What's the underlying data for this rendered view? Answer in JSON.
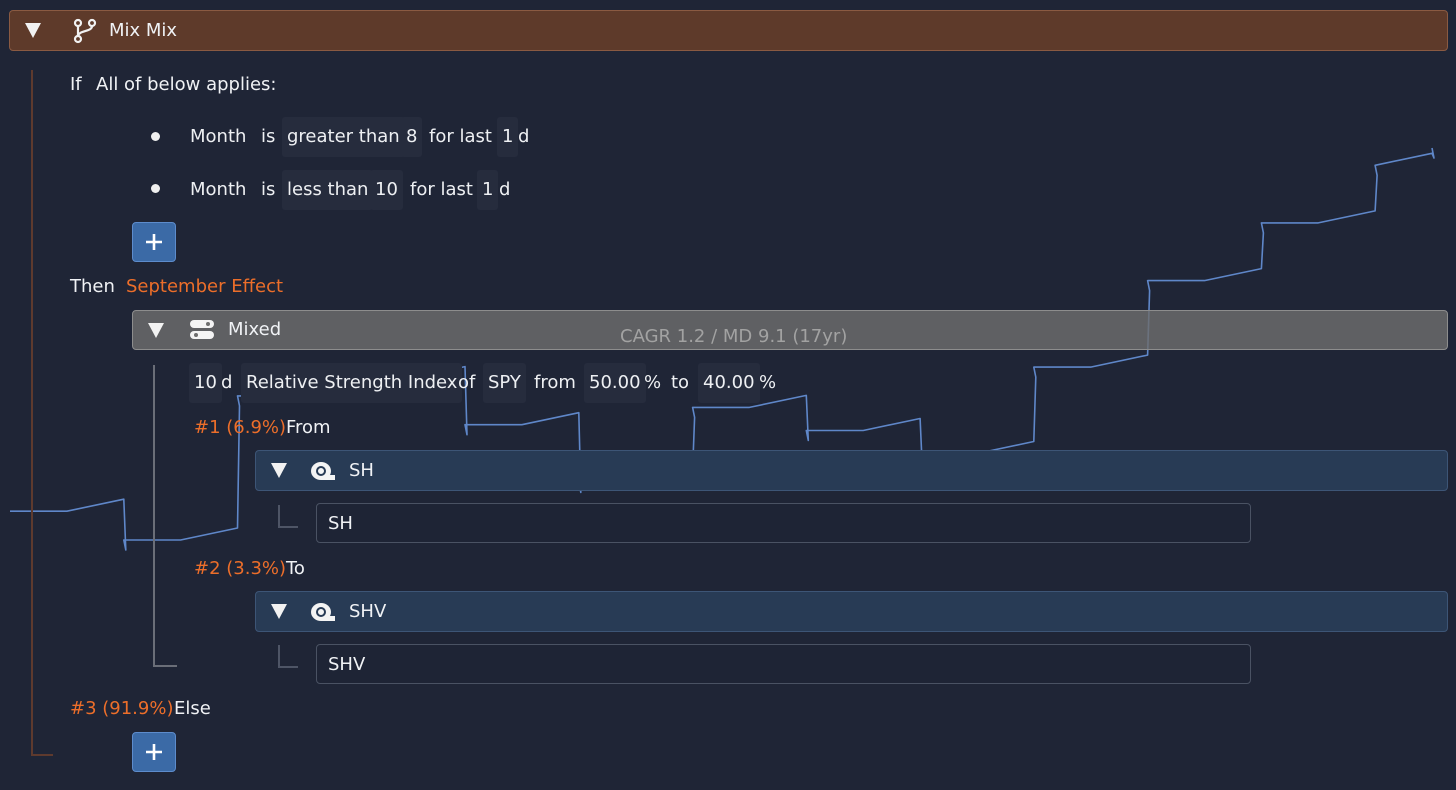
{
  "root": {
    "title": "Mix Mix",
    "icon": "git-branch-icon"
  },
  "if_clause": {
    "if_label": "If",
    "applies_label": "All of below applies:"
  },
  "conditions": [
    {
      "field": "Month",
      "is": "is",
      "op": "greater than",
      "value": "8",
      "for_last": "for last",
      "n": "1",
      "unit": "d"
    },
    {
      "field": "Month",
      "is": "is",
      "op": "less than",
      "value": "10",
      "for_last": "for last",
      "n": "1",
      "unit": "d"
    }
  ],
  "then_clause": {
    "then_label": "Then",
    "name": "September Effect"
  },
  "mixed": {
    "title": "Mixed",
    "icon": "toggle-stack-icon",
    "overlay_text": "CAGR 1.2 / MD 9.1 (17yr)"
  },
  "indicator": {
    "period": "10",
    "period_unit": "d",
    "name": "Relative Strength Index",
    "of": "of",
    "ticker": "SPY",
    "from_label": "from",
    "from_value": "50.00",
    "from_unit": "%",
    "to_label": "to",
    "to_value": "40.00",
    "to_unit": "%"
  },
  "branches": [
    {
      "tag": "#1 (6.9%)",
      "label": "From",
      "group": "SH",
      "ticker": "SH",
      "icon": "coin-icon"
    },
    {
      "tag": "#2 (3.3%)",
      "label": "To",
      "group": "SHV",
      "ticker": "SHV",
      "icon": "coin-icon"
    }
  ],
  "else_clause": {
    "tag": "#3 (91.9%)",
    "label": "Else"
  },
  "colors": {
    "header_brown": "#5e3a2a",
    "accent_orange": "#ec6e2a",
    "button_blue": "#3b6aa6",
    "chart_line": "#5f87c9",
    "subheader_navy": "#283b55"
  },
  "chart_data": {
    "type": "line",
    "note_axes": "no axes, ticks or labels shown",
    "x": [
      0,
      1,
      2,
      3,
      4,
      5,
      6,
      7,
      8,
      9,
      10,
      11,
      12,
      13,
      14,
      15,
      16,
      17,
      18,
      19,
      20,
      21,
      22,
      23,
      24,
      25
    ],
    "series": [
      {
        "values": [
          100,
          100,
          95,
          95,
          120,
          120,
          123,
          123,
          115,
          115,
          105,
          105,
          118,
          118,
          114,
          114,
          110,
          110,
          125,
          125,
          140,
          140,
          150,
          150,
          160,
          163
        ]
      }
    ]
  }
}
